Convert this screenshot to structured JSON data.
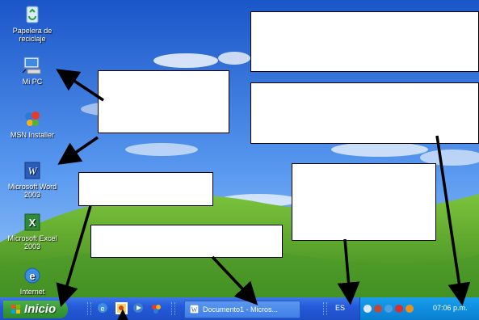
{
  "desktop": {
    "icons": [
      {
        "label": "Papelera de reciclaje",
        "icon": "recycle-bin-icon"
      },
      {
        "label": "Mi PC",
        "icon": "my-computer-icon"
      },
      {
        "label": "MSN Installer",
        "icon": "msn-butterfly-icon"
      },
      {
        "label": "Microsoft Word 2003",
        "icon": "word-icon"
      },
      {
        "label": "Microsoft Excel 2003",
        "icon": "excel-icon"
      },
      {
        "label": "Internet",
        "icon": "internet-explorer-icon"
      }
    ]
  },
  "taskbar": {
    "start_label": "Inicio",
    "quick_launch": [
      "internet-explorer-icon",
      "outlook-express-icon",
      "media-player-icon",
      "msn-icon"
    ],
    "task_button_label": "Documento1 - Micros...",
    "language": "ES",
    "clock": "07:06 p.m.",
    "tray_icons": [
      "back-arrow-icon",
      "network-icon",
      "msn-tray-icon",
      "security-shield-icon",
      "antivirus-icon"
    ]
  },
  "colors": {
    "taskbar_blue": "#2459d9",
    "start_green": "#3a9a3a",
    "tray_blue": "#0f8ee0",
    "sky_blue": "#3f83e0",
    "grass_green": "#4fa533"
  }
}
